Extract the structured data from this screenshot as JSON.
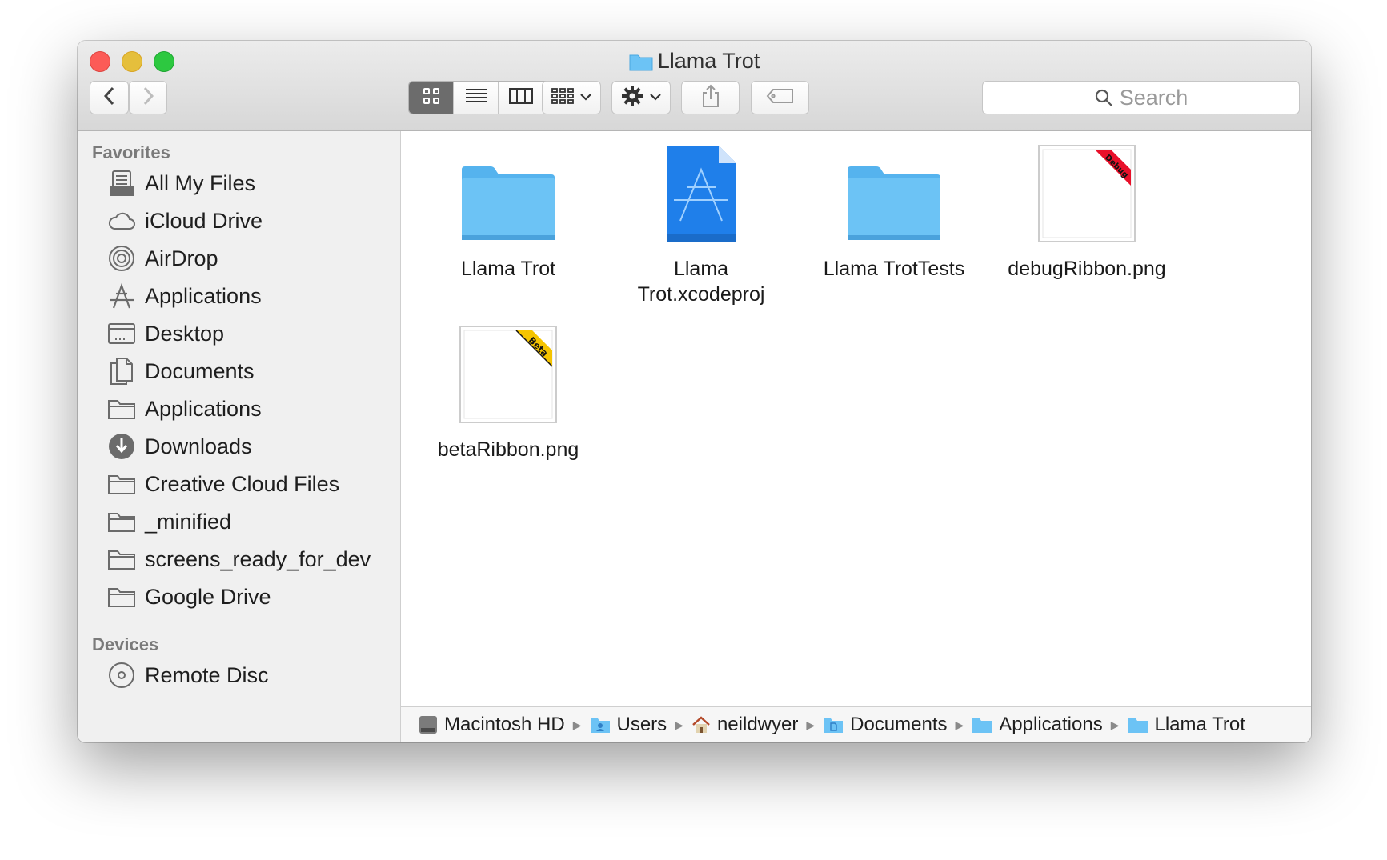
{
  "window": {
    "title": "Llama Trot"
  },
  "toolbar": {
    "search_placeholder": "Search"
  },
  "sidebar": {
    "favorites_header": "Favorites",
    "favorites": [
      {
        "label": "All My Files",
        "icon": "all-files-icon"
      },
      {
        "label": "iCloud Drive",
        "icon": "cloud-icon"
      },
      {
        "label": "AirDrop",
        "icon": "airdrop-icon"
      },
      {
        "label": "Applications",
        "icon": "applications-icon"
      },
      {
        "label": "Desktop",
        "icon": "desktop-icon"
      },
      {
        "label": "Documents",
        "icon": "documents-icon"
      },
      {
        "label": "Applications",
        "icon": "folder-icon"
      },
      {
        "label": "Downloads",
        "icon": "downloads-icon"
      },
      {
        "label": "Creative Cloud Files",
        "icon": "folder-icon"
      },
      {
        "label": "_minified",
        "icon": "folder-icon"
      },
      {
        "label": "screens_ready_for_dev",
        "icon": "folder-icon"
      },
      {
        "label": "Google Drive",
        "icon": "folder-icon"
      }
    ],
    "devices_header": "Devices",
    "devices": [
      {
        "label": "Remote Disc",
        "icon": "disc-icon"
      }
    ]
  },
  "files": [
    {
      "name": "Llama Trot",
      "kind": "folder"
    },
    {
      "name": "Llama Trot.xcodeproj",
      "kind": "xcodeproj"
    },
    {
      "name": "Llama TrotTests",
      "kind": "folder"
    },
    {
      "name": "debugRibbon.png",
      "kind": "image",
      "ribbon_text": "Debug",
      "ribbon_color": "#e8102a"
    },
    {
      "name": "betaRibbon.png",
      "kind": "image",
      "ribbon_text": "Beta",
      "ribbon_color": "#f5c400"
    }
  ],
  "path": [
    {
      "label": "Macintosh HD",
      "icon": "hard-drive-icon"
    },
    {
      "label": "Users",
      "icon": "users-folder-icon"
    },
    {
      "label": "neildwyer",
      "icon": "home-icon"
    },
    {
      "label": "Documents",
      "icon": "documents-folder-icon"
    },
    {
      "label": "Applications",
      "icon": "folder-icon"
    },
    {
      "label": "Llama Trot",
      "icon": "folder-icon"
    }
  ],
  "colors": {
    "folder_blue": "#6cc3f5",
    "xcode_blue": "#1f7fea"
  }
}
